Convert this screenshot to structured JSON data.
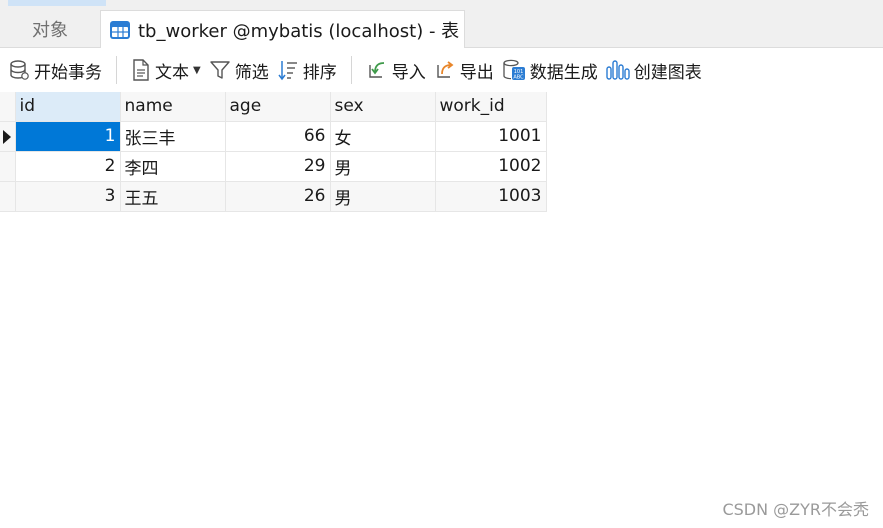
{
  "tabs": {
    "objects_label": "对象",
    "active_label": "tb_worker @mybatis (localhost) - 表"
  },
  "toolbar": {
    "begin_transaction": "开始事务",
    "text": "文本",
    "filter": "筛选",
    "sort": "排序",
    "import": "导入",
    "export": "导出",
    "data_generation": "数据生成",
    "create_chart": "创建图表"
  },
  "grid": {
    "columns": [
      "id",
      "name",
      "age",
      "sex",
      "work_id"
    ],
    "rows": [
      {
        "id": "1",
        "name": "张三丰",
        "age": "66",
        "sex": "女",
        "work_id": "1001"
      },
      {
        "id": "2",
        "name": "李四",
        "age": "29",
        "sex": "男",
        "work_id": "1002"
      },
      {
        "id": "3",
        "name": "王五",
        "age": "26",
        "sex": "男",
        "work_id": "1003"
      }
    ]
  },
  "watermark": "CSDN @ZYR不会秃",
  "colors": {
    "accent": "#0078d7",
    "header_selected": "#dcebf8",
    "icon_blue": "#2b7cd3",
    "icon_orange": "#e8862a",
    "icon_green": "#3f9a4a"
  }
}
